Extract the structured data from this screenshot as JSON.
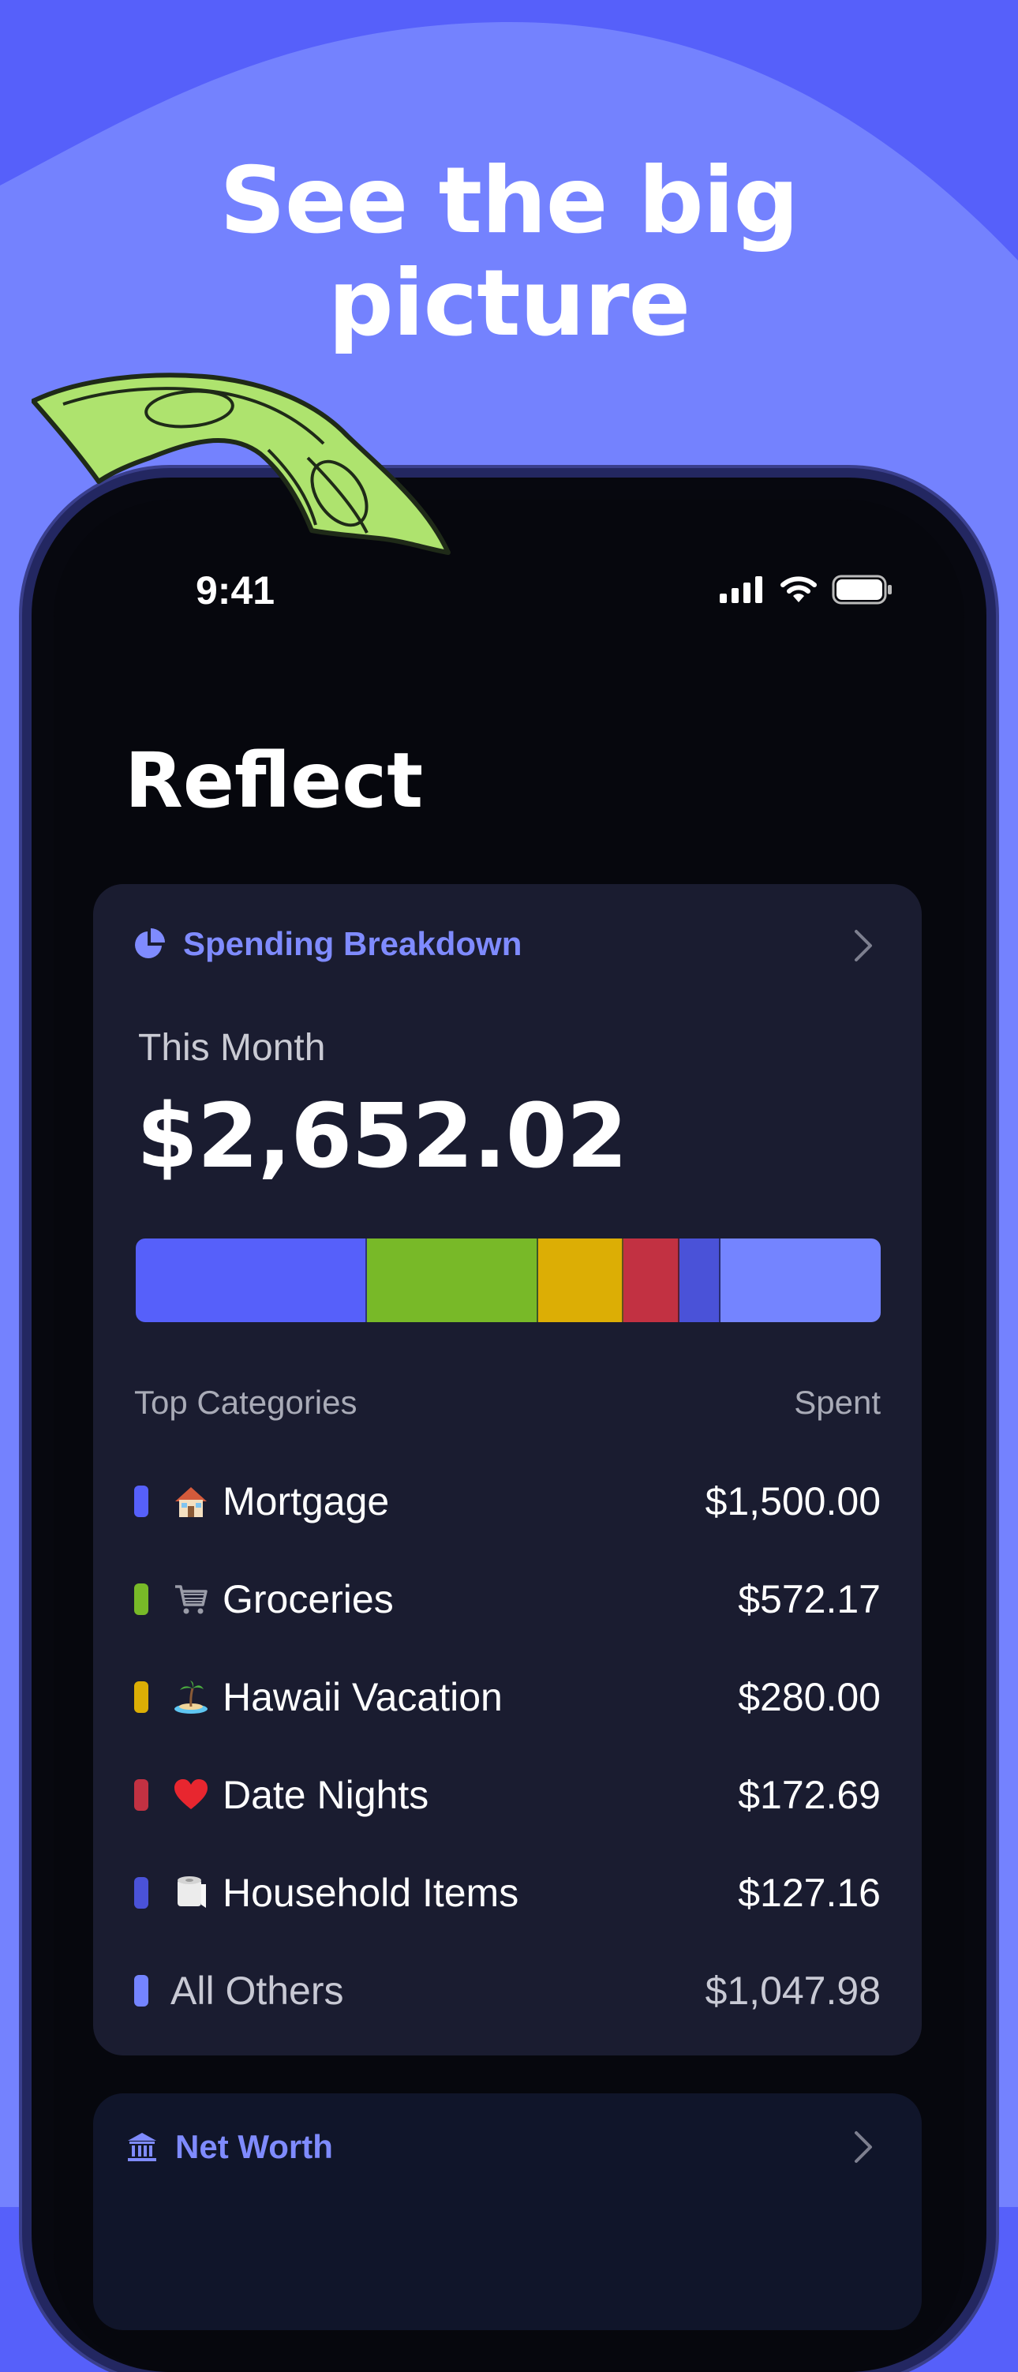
{
  "promo": {
    "headline_line1": "See the big",
    "headline_line2": "picture"
  },
  "status_bar": {
    "time": "9:41"
  },
  "page": {
    "title": "Reflect"
  },
  "spending_card": {
    "title": "Spending Breakdown",
    "period_label": "This Month",
    "total": "$2,652.02",
    "breakdown": [
      {
        "color": "#5660fa",
        "share": 0.31
      },
      {
        "color": "#78b928",
        "share": 0.23
      },
      {
        "color": "#dcae05",
        "share": 0.115
      },
      {
        "color": "#c23142",
        "share": 0.075
      },
      {
        "color": "#4a52d8",
        "share": 0.055
      },
      {
        "color": "#7484ff",
        "share": 0.215
      }
    ],
    "list_header_left": "Top Categories",
    "list_header_right": "Spent",
    "categories": [
      {
        "icon": "house-icon",
        "name": "Mortgage",
        "amount": "$1,500.00",
        "color": "#5660fa"
      },
      {
        "icon": "shopping-cart-icon",
        "name": "Groceries",
        "amount": "$572.17",
        "color": "#78b928"
      },
      {
        "icon": "island-icon",
        "name": "Hawaii Vacation",
        "amount": "$280.00",
        "color": "#dcae05"
      },
      {
        "icon": "heart-icon",
        "name": "Date Nights",
        "amount": "$172.69",
        "color": "#c23142"
      },
      {
        "icon": "toilet-paper-icon",
        "name": "Household Items",
        "amount": "$127.16",
        "color": "#4a52d8"
      },
      {
        "icon": "",
        "name": "All Others",
        "amount": "$1,047.98",
        "color": "#7484ff"
      }
    ]
  },
  "net_worth_card": {
    "title": "Net Worth"
  },
  "colors": {
    "accent": "#7f8bff",
    "background": "#5660fa",
    "card": "#1a1c30"
  }
}
